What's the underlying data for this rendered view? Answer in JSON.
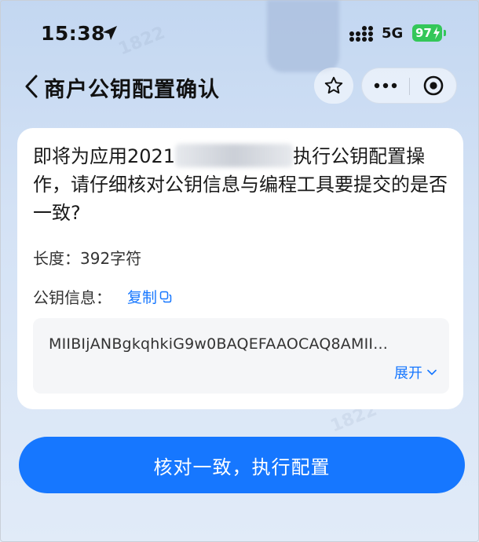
{
  "status_bar": {
    "time": "15:38",
    "network": "5G",
    "battery": "97"
  },
  "nav": {
    "title": "商户公钥配置确认"
  },
  "card": {
    "question_before": "即将为应用2021",
    "question_after": "执行公钥配置操作，请仔细核对公钥信息与编程工具要提交的是否一致?",
    "length_label": "长度：",
    "length_value": "392字符",
    "key_label": "公钥信息：",
    "copy_label": "复制",
    "key_value": "MIIBIjANBgkqhkiG9w0BAQEFAAOCAQ8AMII...",
    "expand_label": "展开"
  },
  "confirm_label": "核对一致，执行配置",
  "watermark_text": "1822",
  "colors": {
    "accent": "#1677ff",
    "battery": "#34c759",
    "card_bg": "#ffffff",
    "key_box_bg": "#f5f6f8"
  },
  "icons": {
    "location": "location-arrow-icon",
    "signal": "cellular-signal-icon",
    "battery_bolt": "battery-charging-icon",
    "back": "chevron-left-icon",
    "star": "star-outline-icon",
    "more": "more-dots-icon",
    "close": "target-circle-icon",
    "copy": "copy-icon",
    "expand": "chevron-down-icon"
  }
}
